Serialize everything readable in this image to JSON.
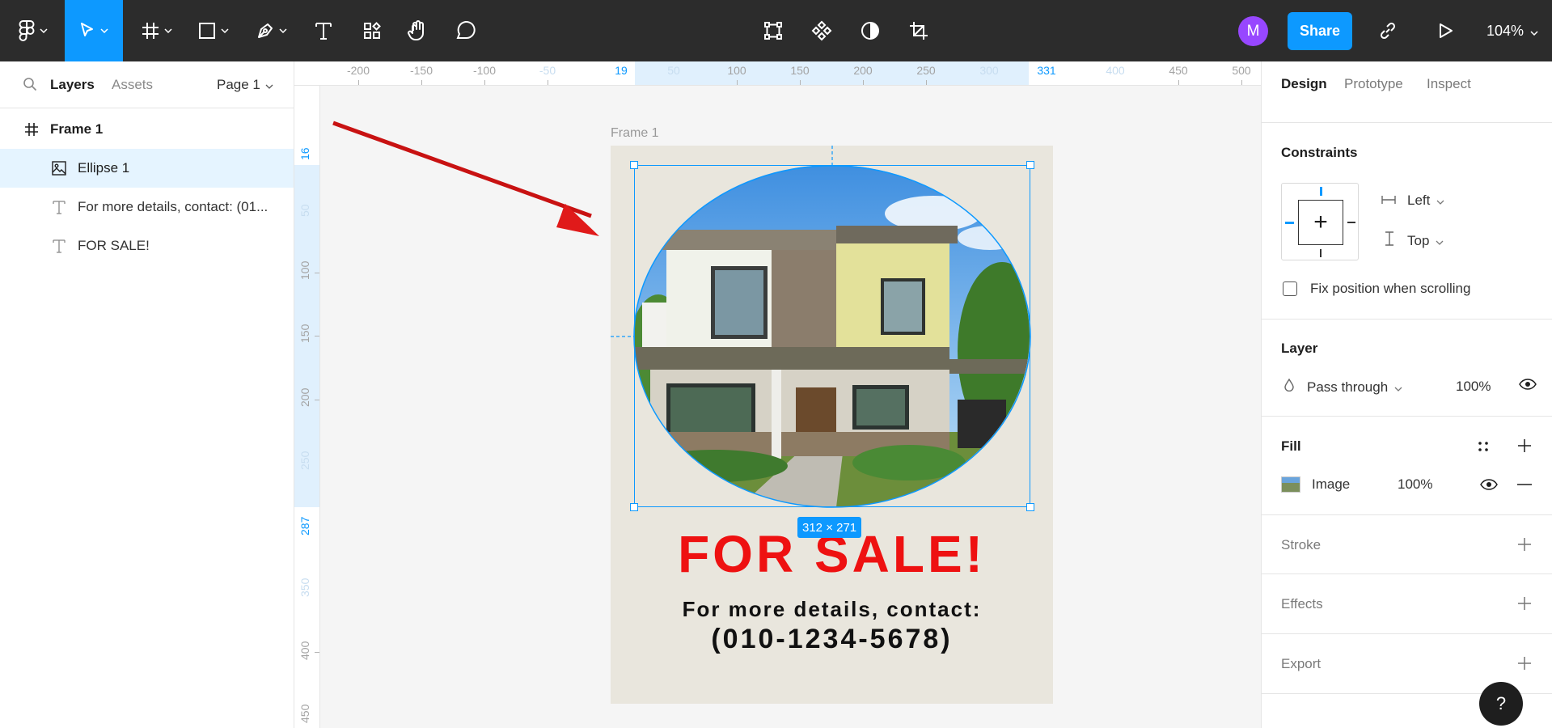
{
  "toolbar": {
    "tools": [
      "main-menu",
      "move",
      "frame",
      "shape",
      "pen",
      "text",
      "resources",
      "hand",
      "comment"
    ],
    "center_tools": [
      "edit-object",
      "component",
      "mask",
      "crop"
    ],
    "avatar_initial": "M",
    "share_label": "Share",
    "zoom": "104%"
  },
  "left_panel": {
    "tabs": {
      "layers": "Layers",
      "assets": "Assets"
    },
    "page": "Page 1",
    "layers": [
      {
        "name": "Frame 1",
        "type": "frame"
      },
      {
        "name": "Ellipse 1",
        "type": "image",
        "selected": true
      },
      {
        "name": "For more details, contact: (01...",
        "type": "text"
      },
      {
        "name": "FOR SALE!",
        "type": "text"
      }
    ]
  },
  "rulers": {
    "top": [
      "-200",
      "-150",
      "-100",
      "-50",
      "19",
      "50",
      "100",
      "150",
      "200",
      "250",
      "300",
      "331",
      "400",
      "450",
      "500"
    ],
    "left": [
      "16",
      "50",
      "100",
      "150",
      "200",
      "250",
      "287",
      "350",
      "400",
      "450"
    ]
  },
  "canvas": {
    "frame_label": "Frame 1",
    "sale_text": "FOR SALE!",
    "contact_line1": "For more details, contact:",
    "contact_line2": "(010-1234-5678)",
    "size_badge": "312 × 271"
  },
  "right_panel": {
    "tabs": [
      "Design",
      "Prototype",
      "Inspect"
    ],
    "constraints": {
      "title": "Constraints",
      "horizontal": "Left",
      "vertical": "Top",
      "fix_label": "Fix position when scrolling",
      "fix_checked": false
    },
    "layer": {
      "title": "Layer",
      "blend": "Pass through",
      "opacity": "100%"
    },
    "fill": {
      "title": "Fill",
      "type": "Image",
      "opacity": "100%"
    },
    "stroke_title": "Stroke",
    "effects_title": "Effects",
    "export_title": "Export"
  },
  "help_label": "?"
}
